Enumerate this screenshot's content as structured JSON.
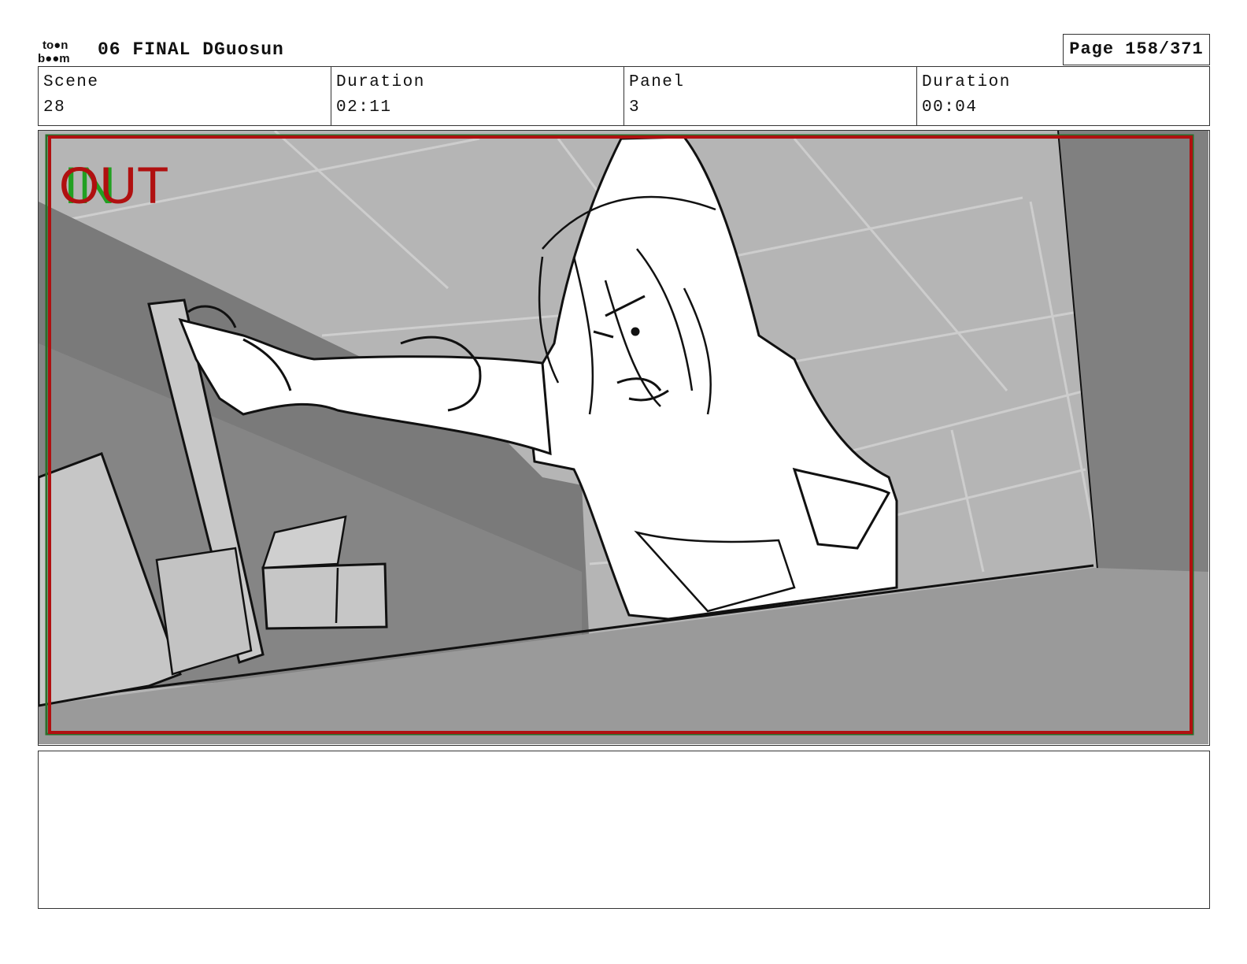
{
  "header": {
    "logo_top": "to●n",
    "logo_bottom": "b●●m",
    "title": "06 FINAL DGuosun",
    "page": "Page 158/371"
  },
  "info": {
    "scene_label": "Scene",
    "scene_value": "28",
    "scene_duration_label": "Duration",
    "scene_duration_value": "02:11",
    "panel_label": "Panel",
    "panel_value": "3",
    "panel_duration_label": "Duration",
    "panel_duration_value": "00:04"
  },
  "frame": {
    "in_marker": "IN",
    "out_marker": "OUT",
    "in_color": "#22a022",
    "out_color": "#b01010",
    "safe_frame_color": "#b01010"
  },
  "notes": {
    "text": ""
  }
}
